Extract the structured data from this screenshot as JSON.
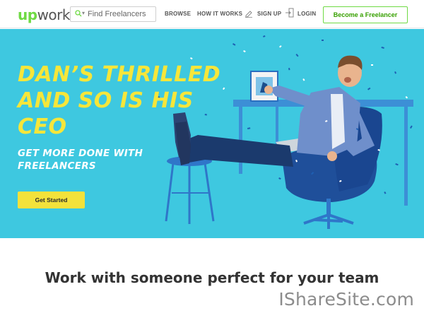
{
  "header": {
    "logo_up": "up",
    "logo_work": "work",
    "search": {
      "placeholder": "Find Freelancers"
    },
    "nav": {
      "browse": "BROWSE",
      "how_it_works": "HOW IT WORKS",
      "sign_up": "SIGN UP",
      "login": "LOGIN"
    },
    "become_freelancer": "Become a Freelancer"
  },
  "hero": {
    "headline_line1": "DAN’S THRILLED",
    "headline_line2": "AND SO IS HIS",
    "headline_line3": "CEO",
    "subline_line1": "GET MORE DONE WITH",
    "subline_line2": "FREELANCERS",
    "cta": "Get Started"
  },
  "main": {
    "tagline": "Work with someone perfect for your team"
  },
  "watermark": "IShareSite.com",
  "colors": {
    "brand_green": "#6fda44",
    "hero_bg": "#3ec8e0",
    "headline_yellow": "#f6e63a",
    "cta_yellow": "#f3e23b"
  },
  "icons": [
    "search-icon",
    "chevron-down-icon",
    "pencil-icon",
    "login-icon"
  ]
}
